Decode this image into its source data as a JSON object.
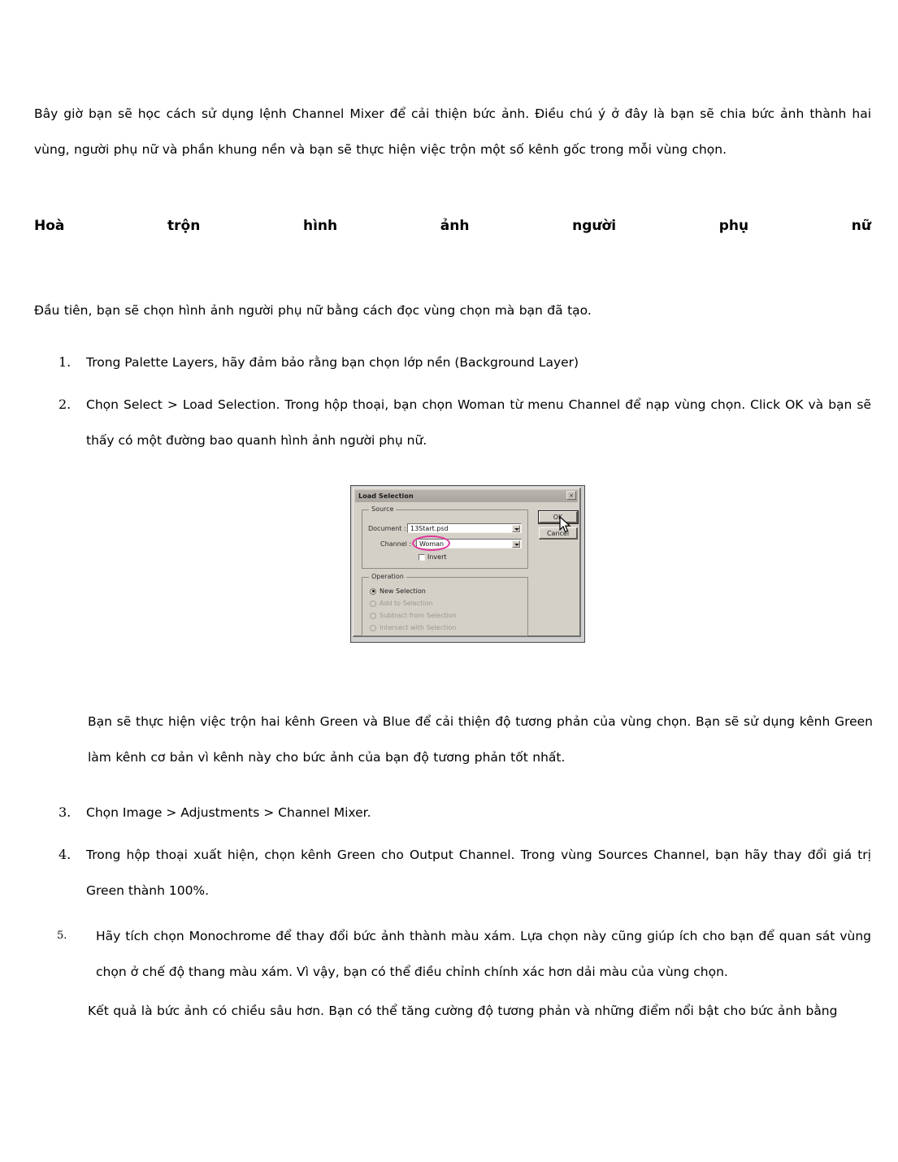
{
  "document": {
    "intro_paragraph": "Bây giờ bạn sẽ học cách sử dụng lệnh Channel Mixer để cải thiện bức ảnh. Điều chú ý ở đây là bạn sẽ chia bức ảnh thành hai vùng, người phụ nữ và phần khung nền và bạn sẽ thực hiện việc trộn một số kênh gốc trong mỗi vùng chọn.",
    "heading_words": [
      "Hoà",
      "trộn",
      "hình",
      "ảnh",
      "người",
      "phụ",
      "nữ"
    ],
    "first_paragraph": "Đầu tiên, bạn sẽ chọn hình ảnh người phụ nữ bằng cách đọc vùng chọn mà bạn đã tạo.",
    "steps_a": [
      {
        "number": "1.",
        "text": "Trong Palette Layers, hãy đảm bảo rằng bạn chọn lớp nền (Background Layer)"
      },
      {
        "number": "2.",
        "text": "Chọn Select > Load Selection. Trong hộp thoại, bạn chọn Woman từ menu Channel để nạp vùng chọn. Click OK và bạn sẽ thấy có một đường bao quanh hình ảnh người phụ nữ."
      }
    ],
    "indented_paragraph": "Bạn sẽ thực hiện việc trộn hai kênh Green và Blue để cải thiện độ tương phản của vùng chọn. Bạn sẽ sử dụng kênh Green làm kênh cơ bản vì kênh này cho bức ảnh của bạn độ tương phản tốt nhất.",
    "steps_b": [
      {
        "number": "3.",
        "text": "Chọn Image > Adjustments > Channel Mixer."
      },
      {
        "number": "4.",
        "text": "Trong hộp thoại xuất hiện, chọn kênh Green cho Output Channel. Trong vùng Sources Channel, bạn hãy thay đổi giá trị Green thành 100%."
      }
    ],
    "steps_c": [
      {
        "number": "5.",
        "text": "Hãy tích chọn Monochrome để thay đổi bức ảnh thành màu xám. Lựa chọn này cũng giúp ích cho bạn để quan sát vùng chọn ở chế độ thang màu xám. Vì vậy, bạn có thể điều chỉnh chính xác hơn dải màu của vùng chọn."
      }
    ],
    "tail_paragraph": "Kết quả là bức ảnh có chiều sâu hơn. Bạn có thể tăng cường độ tương phản và những điểm nổi bật cho bức ảnh bằng"
  },
  "dialog": {
    "title": "Load Selection",
    "close_label": "×",
    "source_group_label": "Source",
    "document_label": "Document :",
    "document_value": "13Start.psd",
    "channel_label": "Channel :",
    "channel_value": "Woman",
    "invert_label": "Invert",
    "operation_group_label": "Operation",
    "operations": [
      {
        "label": "New Selection",
        "selected": true,
        "enabled": true
      },
      {
        "label": "Add to Selection",
        "selected": false,
        "enabled": false
      },
      {
        "label": "Subtract from Selection",
        "selected": false,
        "enabled": false
      },
      {
        "label": "Intersect with Selection",
        "selected": false,
        "enabled": false
      }
    ],
    "ok_label": "OK",
    "cancel_label": "Cancel",
    "highlight_color": "#e0389a"
  }
}
